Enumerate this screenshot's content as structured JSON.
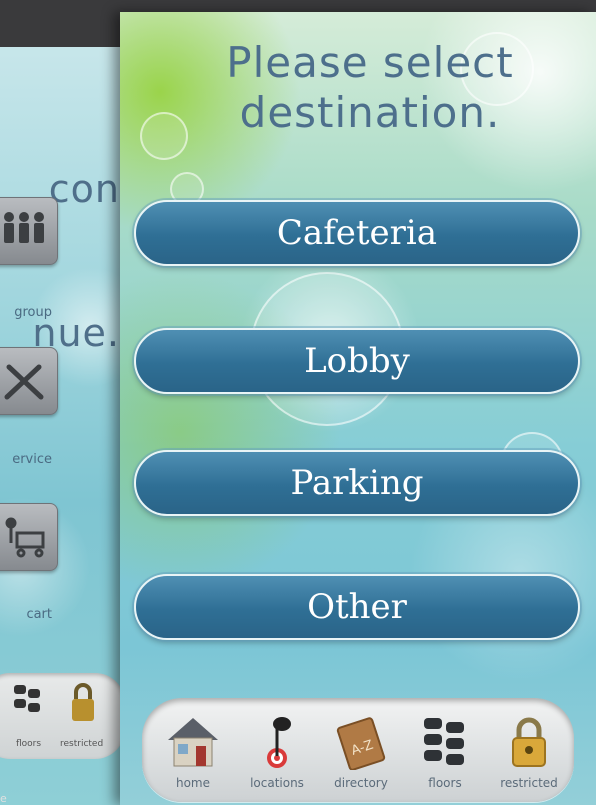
{
  "back_screen": {
    "heading_lines": [
      "con",
      "nue."
    ],
    "items": [
      {
        "label": "group",
        "icon": "people-icon"
      },
      {
        "label": "ervice",
        "icon": "tools-icon"
      },
      {
        "label": "cart",
        "icon": "cart-icon"
      }
    ],
    "dock": [
      {
        "label": "floors",
        "icon": "floors-icon"
      },
      {
        "label": "restricted",
        "icon": "padlock-icon"
      }
    ],
    "stray_mark": "e"
  },
  "front_screen": {
    "title_lines": [
      "Please select",
      "destination."
    ],
    "destinations": [
      {
        "label": "Cafeteria"
      },
      {
        "label": "Lobby"
      },
      {
        "label": "Parking"
      },
      {
        "label": "Other"
      }
    ],
    "dock": [
      {
        "label": "home",
        "icon": "house-icon"
      },
      {
        "label": "locations",
        "icon": "map-pin-target-icon"
      },
      {
        "label": "directory",
        "icon": "a-z-book-icon"
      },
      {
        "label": "floors",
        "icon": "floors-icon"
      },
      {
        "label": "restricted",
        "icon": "padlock-icon"
      }
    ]
  },
  "colors": {
    "button_blue": "#2f6f95",
    "title_text": "#4d6f8c",
    "dock_label": "#5b6b7a"
  }
}
